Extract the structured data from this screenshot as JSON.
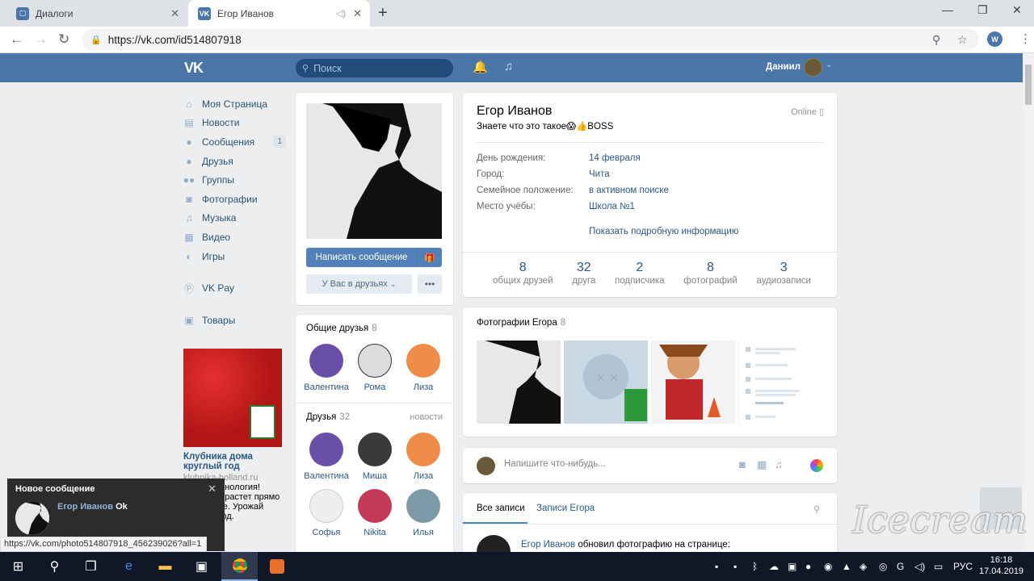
{
  "browser": {
    "tabs": [
      {
        "title": "Диалоги",
        "active": false
      },
      {
        "title": "Егор Иванов",
        "active": true
      }
    ],
    "url": "https://vk.com/id514807918",
    "status_url": "https://vk.com/photo514807918_456239026?all=1",
    "ext_label": "W"
  },
  "vk": {
    "logo": "VK",
    "search_placeholder": "Поиск",
    "user_name": "Даниил",
    "accent": "#4a76a8"
  },
  "left_nav": [
    {
      "icon": "home-icon",
      "label": "Моя Страница"
    },
    {
      "icon": "news-icon",
      "label": "Новости"
    },
    {
      "icon": "messages-icon",
      "label": "Сообщения",
      "count": "1"
    },
    {
      "icon": "friends-icon",
      "label": "Друзья"
    },
    {
      "icon": "groups-icon",
      "label": "Группы"
    },
    {
      "icon": "photos-icon",
      "label": "Фотографии"
    },
    {
      "icon": "music-icon",
      "label": "Музыка"
    },
    {
      "icon": "video-icon",
      "label": "Видео"
    },
    {
      "icon": "games-icon",
      "label": "Игры"
    }
  ],
  "left_nav_extra": [
    {
      "icon": "vkpay-icon",
      "label": "VK Pay"
    },
    {
      "icon": "goods-icon",
      "label": "Товары"
    }
  ],
  "ad": {
    "title": "Клубника дома круглый год",
    "url": "klubnika-holland.ru",
    "text": "Новая технология! Клубника растет прямо в квартире. Урожай круглый год."
  },
  "profile": {
    "name": "Егор Иванов",
    "status": "Знаете что это такое😱👍BOSS",
    "online": "Online",
    "write_button": "Написать сообщение",
    "friends_button": "У Вас в друзьях",
    "more_button": "•••",
    "info": [
      {
        "label": "День рождения:",
        "value": "14 февраля"
      },
      {
        "label": "Город:",
        "value": "Чита"
      },
      {
        "label": "Семейное положение:",
        "value": "в активном поиске"
      },
      {
        "label": "Место учёбы:",
        "value": "Школа №1"
      }
    ],
    "show_more": "Показать подробную информацию",
    "counters": [
      {
        "num": "8",
        "label": "общих друзей"
      },
      {
        "num": "32",
        "label": "друга"
      },
      {
        "num": "2",
        "label": "подписчика"
      },
      {
        "num": "8",
        "label": "фотографий"
      },
      {
        "num": "3",
        "label": "аудиозаписи"
      }
    ]
  },
  "mutual": {
    "title": "Общие друзья",
    "count": "8",
    "people": [
      {
        "name": "Валентина",
        "color": "#6a4fa8"
      },
      {
        "name": "Рома",
        "color": "#ddd"
      },
      {
        "name": "Лиза",
        "color": "#f08c4a"
      }
    ]
  },
  "friends": {
    "title": "Друзья",
    "count": "32",
    "news": "новости",
    "people": [
      {
        "name": "Валентина",
        "color": "#6a4fa8"
      },
      {
        "name": "Миша",
        "color": "#3a3a3a"
      },
      {
        "name": "Лиза",
        "color": "#f08c4a"
      }
    ],
    "people2": [
      {
        "name": "Софья",
        "color": "#eee"
      },
      {
        "name": "Nikita",
        "color": "#c43b5a"
      },
      {
        "name": "Илья",
        "color": "#7d9aa8"
      }
    ]
  },
  "photos": {
    "title": "Фотографии Егора",
    "count": "8"
  },
  "post": {
    "placeholder": "Напишите что-нибудь..."
  },
  "wall": {
    "tab_all": "Все записи",
    "tab_user": "Записи Егора",
    "post_author": "Егор Иванов",
    "post_text": "обновил фотографию на странице:"
  },
  "notification": {
    "title": "Новое сообщение",
    "from": "Егор Иванов",
    "text": "Ok"
  },
  "taskbar": {
    "lang": "РУС",
    "time": "16:18",
    "date": "17.04.2019"
  },
  "watermark": "Icecream"
}
